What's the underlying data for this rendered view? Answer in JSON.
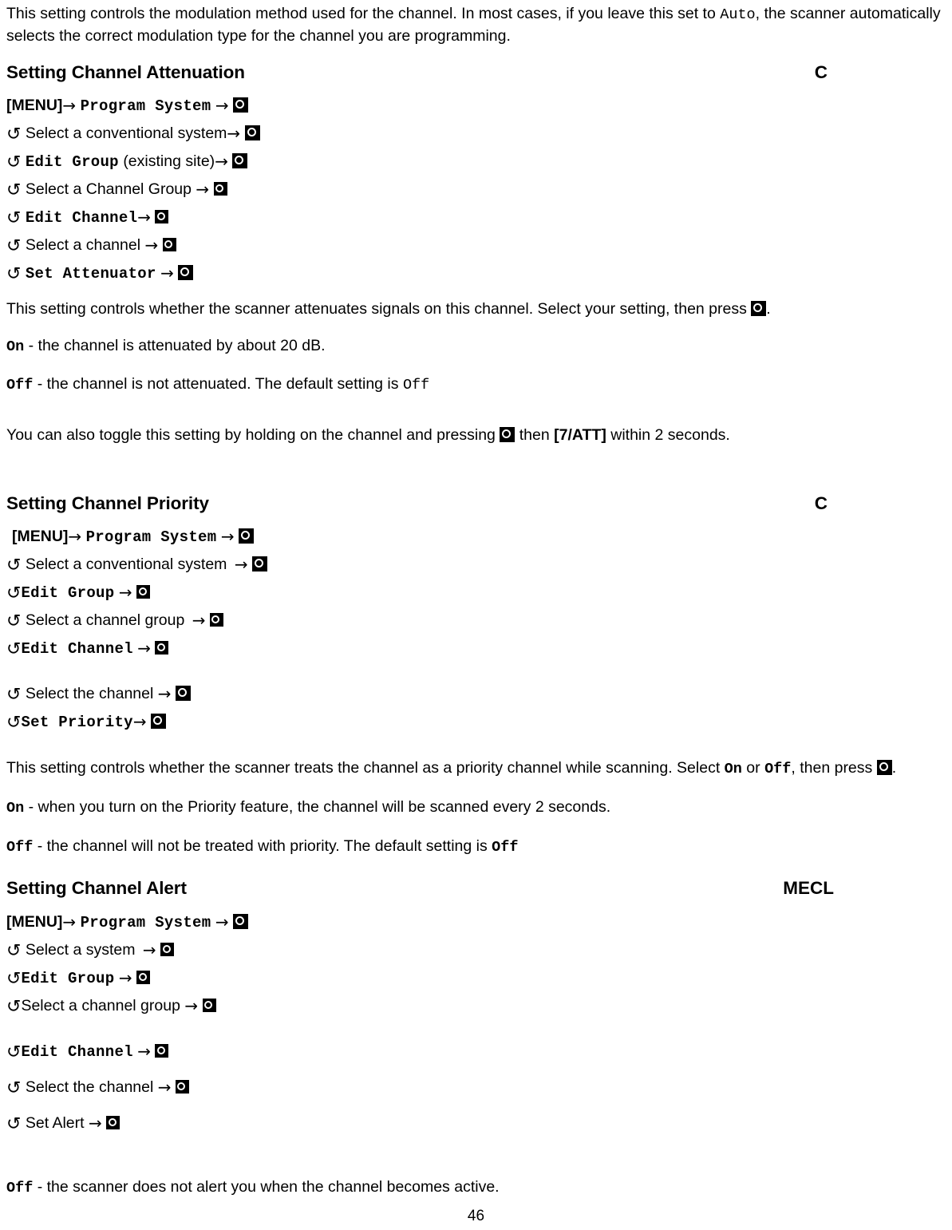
{
  "document": {
    "page_number": "46"
  },
  "intro": {
    "text_before": "This setting controls the modulation method used for the channel. In most cases, if you leave this set to ",
    "mono_value": "Auto",
    "text_after": ", the scanner automatically selects the correct modulation type for the channel you are programming."
  },
  "icons": {
    "rotate": "↺",
    "arrow": "→",
    "knob": "enter-knob-icon"
  },
  "sections": [
    {
      "id": "attenuation",
      "title": "Setting Channel Attenuation",
      "marker": "C",
      "steps": [
        {
          "prefix": "menu",
          "label": "[MENU]",
          "arrow": "→",
          "label2": "Program System",
          "label2_style": "mono",
          "arrow2": "→",
          "knob": true
        },
        {
          "prefix": "rotate",
          "label": "Select a conventional system",
          "label_style": "plain",
          "arrow": "→",
          "knob": true
        },
        {
          "prefix": "rotate",
          "label": "Edit Group",
          "label_style": "mono",
          "suffix": "(existing site)",
          "arrow": "→",
          "knob": true
        },
        {
          "prefix": "rotate",
          "label": "Select a Channel Group",
          "label_style": "plain",
          "arrow": "→",
          "knob": true
        },
        {
          "prefix": "rotate",
          "label": "Edit Channel",
          "label_style": "mono",
          "arrow": "→",
          "knob": true
        },
        {
          "prefix": "rotate",
          "label": "Select a channel",
          "label_style": "plain",
          "arrow": "→",
          "knob": true
        },
        {
          "prefix": "rotate",
          "label": "Set Attenuator",
          "label_style": "mono",
          "arrow": "→",
          "knob": true
        }
      ],
      "body": {
        "lead": "This setting controls whether the scanner attenuates signals on this channel. Select your setting, then press ",
        "lead_tail": ".",
        "on_value": "On",
        "on_text": " - the channel is attenuated by about 20 dB.",
        "off_value": "Off",
        "off_text": " - the channel is not attenuated. The default setting is ",
        "off_default": "Off",
        "note_before": "You can also toggle this setting by holding on the channel and pressing ",
        "note_mid": " then ",
        "note_key": "[7/ATT]",
        "note_after": " within 2 seconds."
      }
    },
    {
      "id": "priority",
      "title": "Setting Channel Priority",
      "marker": "C",
      "steps": [
        {
          "prefix": "menu",
          "label": "[MENU]",
          "arrow": "→",
          "label2": "Program System",
          "label2_style": "mono",
          "arrow2": "→",
          "knob": true
        },
        {
          "prefix": "rotate",
          "label": "Select a conventional system",
          "label_style": "plain",
          "arrow": "→",
          "knob": true
        },
        {
          "prefix": "rotate",
          "label": "Edit Group",
          "label_style": "mono",
          "arrow": "→",
          "knob": true
        },
        {
          "prefix": "rotate",
          "label": "Select a channel group",
          "label_style": "plain",
          "arrow": "→",
          "knob": true
        },
        {
          "prefix": "rotate",
          "label": "Edit Channel",
          "label_style": "mono",
          "arrow": "→",
          "knob": true
        },
        {
          "prefix": "rotate",
          "label": "Select the channel",
          "label_style": "plain",
          "arrow": "→",
          "knob": true
        },
        {
          "prefix": "rotate",
          "label": "Set Priority",
          "label_style": "mono",
          "arrow": "→",
          "knob": true
        }
      ],
      "body": {
        "lead_a": "This setting controls whether the scanner treats the channel as a priority channel while scanning. Select ",
        "lead_on": "On",
        "lead_b": " or ",
        "lead_off": "Off",
        "lead_c": ", then press ",
        "lead_tail": ".",
        "on_value": "On",
        "on_text": " - when you turn on the Priority feature, the channel will be scanned every 2 seconds.",
        "off_value": "Off",
        "off_text": " - the channel will not be treated with priority. The default setting is ",
        "off_default": "Off"
      }
    },
    {
      "id": "alert",
      "title": "Setting Channel Alert",
      "marker": "MECL",
      "steps": [
        {
          "prefix": "menu",
          "label": "[MENU]",
          "arrow": "→",
          "label2": "Program System",
          "label2_style": "mono",
          "arrow2": "→",
          "knob": true
        },
        {
          "prefix": "rotate",
          "label": "Select a system",
          "label_style": "plain",
          "arrow": "→",
          "knob": true
        },
        {
          "prefix": "rotate",
          "label": "Edit Group",
          "label_style": "mono",
          "arrow": "→",
          "knob": true
        },
        {
          "prefix": "rotate-tight",
          "label": "Select a channel group",
          "label_style": "plain",
          "arrow": "→",
          "knob": true
        },
        {
          "prefix": "rotate",
          "label": "Edit Channel",
          "label_style": "mono",
          "arrow": "→",
          "knob": true
        },
        {
          "prefix": "rotate",
          "label": "Select the channel",
          "label_style": "plain",
          "arrow": "→",
          "knob": true
        },
        {
          "prefix": "rotate",
          "label": "Set Alert",
          "label_style": "plain",
          "arrow": "→",
          "knob": true
        }
      ],
      "body": {
        "off_value": "Off",
        "off_text": " - the scanner does not alert you when the channel becomes active."
      }
    }
  ]
}
